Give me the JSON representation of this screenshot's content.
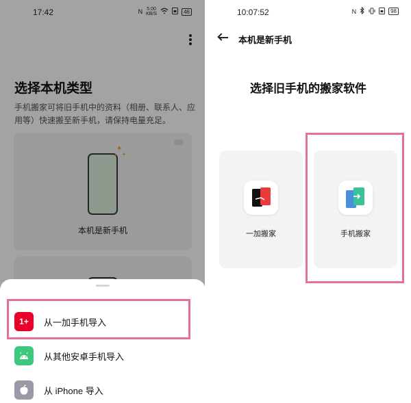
{
  "left": {
    "status": {
      "time": "17:42",
      "net": "N",
      "speed": "5.00 KB/S",
      "battery": "46"
    },
    "title": "选择本机类型",
    "description": "手机搬家可将旧手机中的资料（相册、联系人、应用等）快速搬至新手机，请保持电量充足。",
    "choice_label": "本机是新手机",
    "sheet": {
      "options": [
        {
          "label": "从一加手机导入",
          "icon": "1+",
          "icon_name": "oneplus-icon"
        },
        {
          "label": "从其他安卓手机导入",
          "icon": "◉",
          "icon_name": "android-icon"
        },
        {
          "label": "从 iPhone 导入",
          "icon": "●",
          "icon_name": "apple-icon"
        }
      ]
    }
  },
  "right": {
    "status": {
      "time": "10:07:52",
      "net": "N",
      "battery": "98"
    },
    "header": "本机是新手机",
    "title": "选择旧手机的搬家软件",
    "apps": [
      {
        "label": "一加搬家",
        "icon_name": "oneplus-clone-icon"
      },
      {
        "label": "手机搬家",
        "icon_name": "phone-clone-icon"
      }
    ]
  },
  "colors": {
    "highlight": "#e5709a",
    "oneplus_red": "#eb0029",
    "android_green": "#3dc97d",
    "clone_teal": "#3cc29a",
    "clone_blue": "#4a8fdc"
  }
}
